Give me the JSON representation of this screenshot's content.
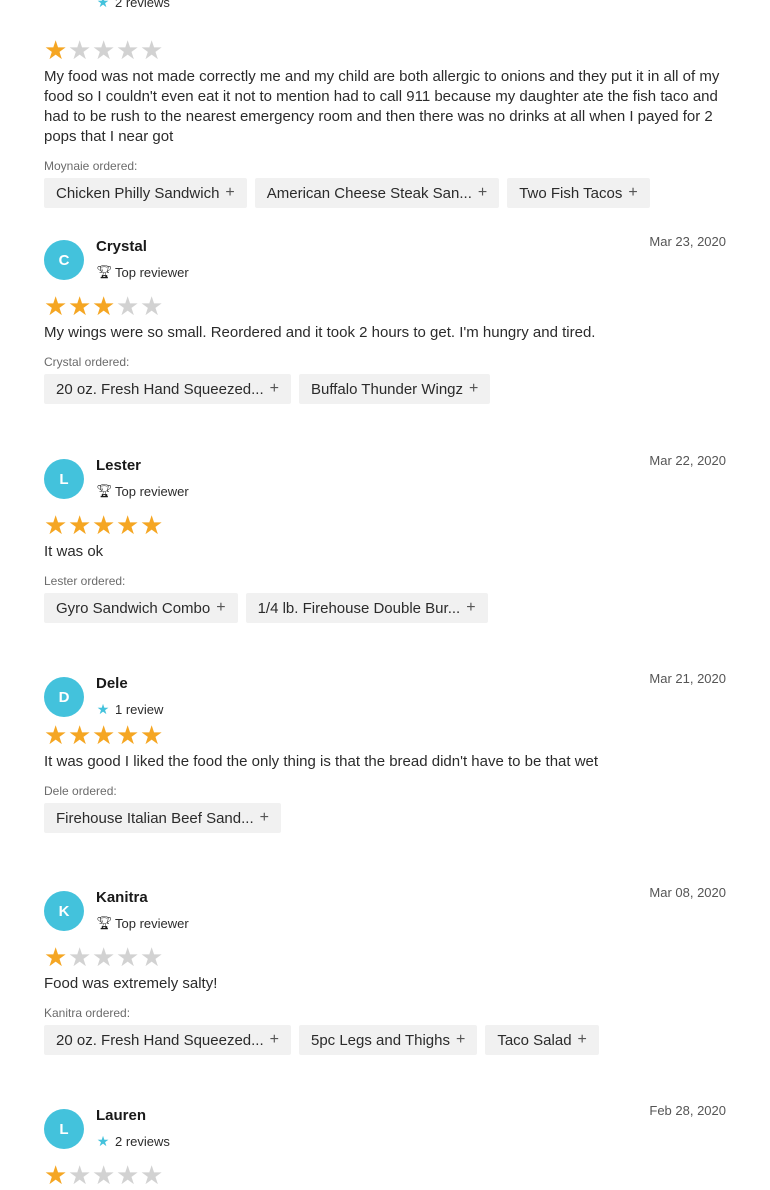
{
  "colors": {
    "avatar": "#43c2dc",
    "star_on": "#f5a623",
    "star_off": "#d2d2d2",
    "chip_bg": "#f1f1f1"
  },
  "icons": {
    "trophy": "trophy-icon",
    "review_star": "star-icon",
    "add": "plus-icon"
  },
  "top_partial": {
    "meta": "2 reviews",
    "rating": 1,
    "text": "My food was not made correctly me and my child are both allergic to onions and they put it in all of my food so I couldn't even eat it not to mention had to call 911 because my daughter ate the fish taco and had to be rush to the nearest emergency room and then there was no drinks at all when I payed for 2 pops that I near got",
    "ordered_label": "Moynaie ordered:",
    "items": [
      "Chicken Philly Sandwich",
      "American Cheese Steak San...",
      "Two Fish Tacos"
    ]
  },
  "reviews": [
    {
      "initial": "C",
      "name": "Crystal",
      "meta": "Top reviewer",
      "date": "Mar 23, 2020",
      "rating": 3,
      "text": "My wings were so small. Reordered and it took 2 hours to get. I'm hungry and tired.",
      "ordered_label": "Crystal ordered:",
      "items": [
        "20 oz. Fresh Hand Squeezed...",
        "Buffalo Thunder Wingz"
      ]
    },
    {
      "initial": "L",
      "name": "Lester",
      "meta": "Top reviewer",
      "date": "Mar 22, 2020",
      "rating": 5,
      "text": "It was ok",
      "ordered_label": "Lester ordered:",
      "items": [
        "Gyro Sandwich Combo",
        "1/4 lb. Firehouse Double Bur..."
      ]
    },
    {
      "initial": "D",
      "name": "Dele",
      "meta": "1 review",
      "date": "Mar 21, 2020",
      "rating": 5,
      "text": "It was good I liked the food the only thing is that the bread didn't have to be that wet",
      "ordered_label": "Dele ordered:",
      "items": [
        "Firehouse Italian Beef Sand..."
      ]
    },
    {
      "initial": "K",
      "name": "Kanitra",
      "meta": "Top reviewer",
      "date": "Mar 08, 2020",
      "rating": 1,
      "text": "Food was extremely salty!",
      "ordered_label": "Kanitra ordered:",
      "items": [
        "20 oz. Fresh Hand Squeezed...",
        "5pc Legs and Thighs",
        "Taco Salad"
      ]
    },
    {
      "initial": "L",
      "name": "Lauren",
      "meta": "2 reviews",
      "date": "Feb 28, 2020",
      "rating": 1
    }
  ]
}
